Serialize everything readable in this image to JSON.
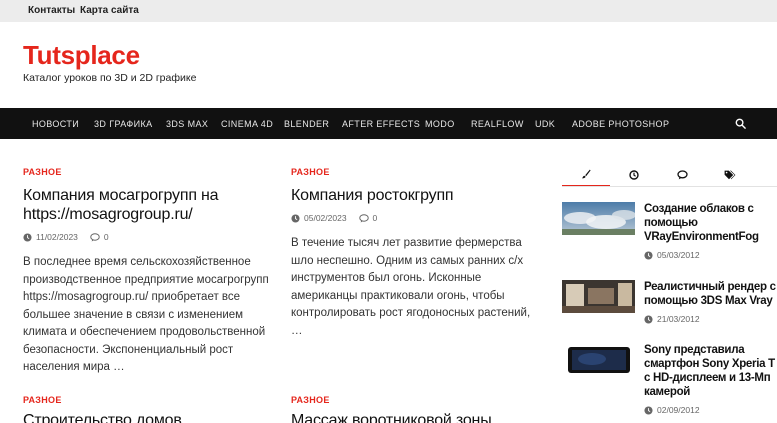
{
  "topbar": {
    "links": [
      "Контакты",
      "Карта сайта"
    ]
  },
  "brand": {
    "title": "Tutsplace",
    "tagline": "Каталог уроков по 3D и 2D графике",
    "accent_color": "#e5261c"
  },
  "nav": {
    "items": [
      "Новости",
      "3D графика",
      "3ds Max",
      "Cinema 4D",
      "Blender",
      "After Effects",
      "Modo",
      "RealFlow",
      "UDK",
      "Adobe Photoshop"
    ],
    "search_icon": "search-icon"
  },
  "posts": [
    {
      "category": "Разное",
      "title": "Компания мосагрогрупп на https://mosagrogroup.ru/",
      "date": "11/02/2023",
      "comments": "0",
      "excerpt": "В последнее время сельскохозяйственное производственное предприятие мосагрогрупп https://mosagrogroup.ru/ приобретает все большее значение в связи с изменением климата и обеспечением продовольственной безопасности. Экспоненциальный рост населения мира …"
    },
    {
      "category": "Разное",
      "title": "Компания ростокгрупп",
      "date": "05/02/2023",
      "comments": "0",
      "excerpt": "В течение тысяч лет развитие фермерства шло неспешно. Одним из самых ранних с/х инструментов был огонь. Исконные американцы практиковали огонь, чтобы контролировать рост ягодоносных растений, …"
    },
    {
      "category": "Разное",
      "title": "Строительство домов"
    },
    {
      "category": "Разное",
      "title": "Массаж воротниковой зоны"
    }
  ],
  "sidebar": {
    "tabs": [
      "brush-icon",
      "clock-icon",
      "comment-icon",
      "tags-icon"
    ],
    "items": [
      {
        "title": "Создание облаков с помощью VRayEnvironmentFog",
        "date": "05/03/2012"
      },
      {
        "title": "Реалистичный рендер с помощью 3DS Max Vray",
        "date": "21/03/2012"
      },
      {
        "title": "Sony представила смартфон Sony Xperia T с HD-дисплеем и 13-Мп камерой",
        "date": "02/09/2012"
      }
    ]
  }
}
